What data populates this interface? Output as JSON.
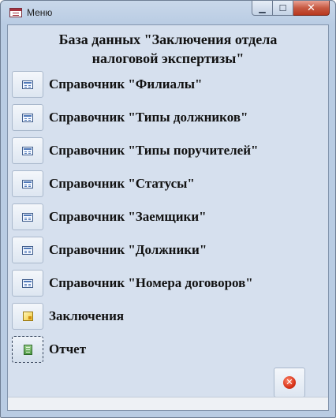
{
  "window": {
    "title": "Меню",
    "minimize_glyph": "▁",
    "maximize_glyph": "☐",
    "close_glyph": "✕"
  },
  "heading": {
    "line1": "База данных \"Заключения отдела",
    "line2": "налоговой экспертизы\""
  },
  "menu": [
    {
      "label": "Справочник \"Филиалы\"",
      "icon": "form-icon"
    },
    {
      "label": "Справочник \"Типы должников\"",
      "icon": "form-icon"
    },
    {
      "label": "Справочник \"Типы поручителей\"",
      "icon": "form-icon"
    },
    {
      "label": "Справочник \"Статусы\"",
      "icon": "form-icon"
    },
    {
      "label": "Справочник \"Заемщики\"",
      "icon": "form-icon"
    },
    {
      "label": "Справочник \"Должники\"",
      "icon": "form-icon"
    },
    {
      "label": "Справочник \"Номера договоров\"",
      "icon": "form-icon"
    },
    {
      "label": "Заключения",
      "icon": "query-icon"
    },
    {
      "label": "Отчет",
      "icon": "report-icon"
    }
  ],
  "exit_button": {
    "icon": "exit-icon",
    "glyph": "✕"
  },
  "colors": {
    "accent_close": "#c75a43",
    "form_background": "#d6e0ee"
  }
}
